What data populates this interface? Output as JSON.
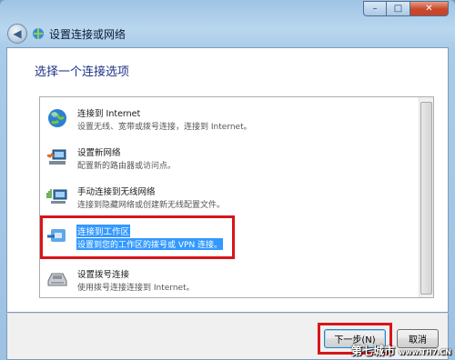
{
  "window": {
    "title": "设置连接或网络",
    "caption": {
      "minimize": "–",
      "maximize": "□",
      "close": "✕"
    },
    "back_icon": "back-arrow-icon"
  },
  "main": {
    "heading": "选择一个连接选项",
    "options": [
      {
        "title": "连接到 Internet",
        "desc": "设置无线、宽带或拨号连接，连接到 Internet。",
        "icon": "globe-internet-icon",
        "selected": false
      },
      {
        "title": "设置新网络",
        "desc": "配置新的路由器或访问点。",
        "icon": "network-setup-icon",
        "selected": false
      },
      {
        "title": "手动连接到无线网络",
        "desc": "连接到隐藏网络或创建新无线配置文件。",
        "icon": "wireless-network-icon",
        "selected": false
      },
      {
        "title": "连接到工作区",
        "desc": "设置到您的工作区的拨号或 VPN 连接。",
        "icon": "workplace-vpn-icon",
        "selected": true
      },
      {
        "title": "设置拨号连接",
        "desc": "使用拨号连接连接到 Internet。",
        "icon": "dialup-modem-icon",
        "selected": false
      }
    ]
  },
  "footer": {
    "next_label": "下一步(N)",
    "cancel_label": "取消"
  },
  "watermark": {
    "text": "第七城市",
    "url": "www.TH7.CN"
  },
  "colors": {
    "selection": "#3399ff",
    "highlight_box": "#d7151b",
    "heading": "#1e3287"
  }
}
